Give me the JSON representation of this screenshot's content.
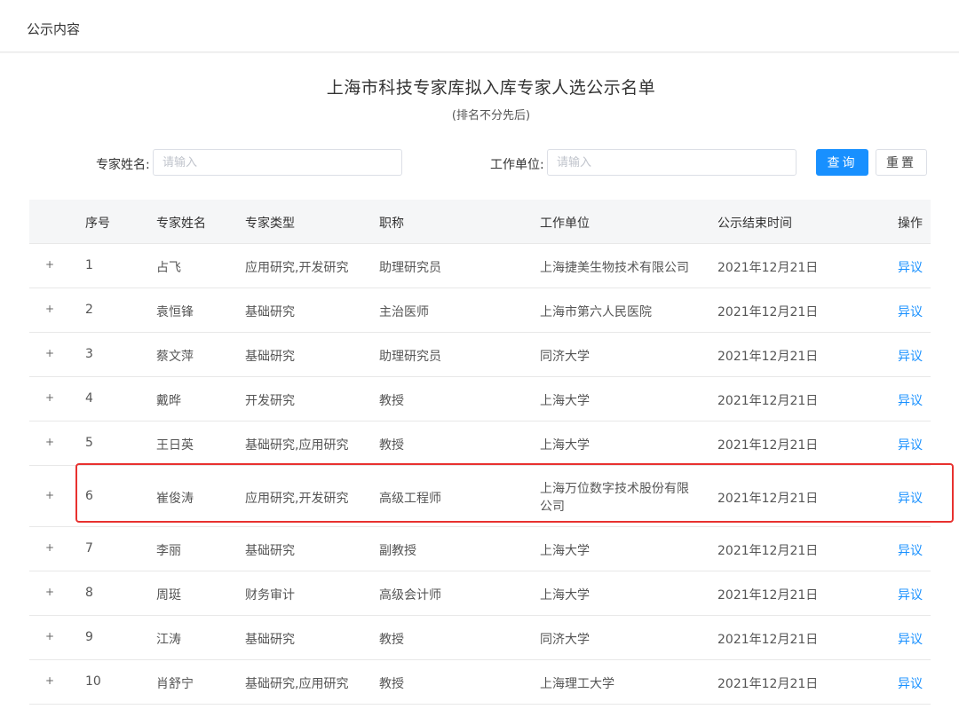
{
  "tab": {
    "title": "公示内容"
  },
  "page": {
    "title": "上海市科技专家库拟入库专家人选公示名单",
    "subtitle": "(排名不分先后)"
  },
  "filters": {
    "name_label": "专家姓名:",
    "name_placeholder": "请输入",
    "name_value": "",
    "unit_label": "工作单位:",
    "unit_placeholder": "请输入",
    "unit_value": "",
    "query_label": "查询",
    "reset_label": "重置"
  },
  "table": {
    "columns": [
      "序号",
      "专家姓名",
      "专家类型",
      "职称",
      "工作单位",
      "公示结束时间",
      "操作"
    ],
    "rows": [
      {
        "expand": "+",
        "no": "1",
        "name": "占飞",
        "type": "应用研究,开发研究",
        "title": "助理研究员",
        "unit": "上海捷美生物技术有限公司",
        "end": "2021年12月21日",
        "action": "异议"
      },
      {
        "expand": "+",
        "no": "2",
        "name": "袁恒锋",
        "type": "基础研究",
        "title": "主治医师",
        "unit": "上海市第六人民医院",
        "end": "2021年12月21日",
        "action": "异议"
      },
      {
        "expand": "+",
        "no": "3",
        "name": "蔡文萍",
        "type": "基础研究",
        "title": "助理研究员",
        "unit": "同济大学",
        "end": "2021年12月21日",
        "action": "异议"
      },
      {
        "expand": "+",
        "no": "4",
        "name": "戴晔",
        "type": "开发研究",
        "title": "教授",
        "unit": "上海大学",
        "end": "2021年12月21日",
        "action": "异议"
      },
      {
        "expand": "+",
        "no": "5",
        "name": "王日英",
        "type": "基础研究,应用研究",
        "title": "教授",
        "unit": "上海大学",
        "end": "2021年12月21日",
        "action": "异议"
      },
      {
        "expand": "+",
        "no": "6",
        "name": "崔俊涛",
        "type": "应用研究,开发研究",
        "title": "高级工程师",
        "unit": "上海万位数字技术股份有限公司",
        "end": "2021年12月21日",
        "action": "异议"
      },
      {
        "expand": "+",
        "no": "7",
        "name": "李丽",
        "type": "基础研究",
        "title": "副教授",
        "unit": "上海大学",
        "end": "2021年12月21日",
        "action": "异议"
      },
      {
        "expand": "+",
        "no": "8",
        "name": "周珽",
        "type": "财务审计",
        "title": "高级会计师",
        "unit": "上海大学",
        "end": "2021年12月21日",
        "action": "异议"
      },
      {
        "expand": "+",
        "no": "9",
        "name": "江涛",
        "type": "基础研究",
        "title": "教授",
        "unit": "同济大学",
        "end": "2021年12月21日",
        "action": "异议"
      },
      {
        "expand": "+",
        "no": "10",
        "name": "肖舒宁",
        "type": "基础研究,应用研究",
        "title": "教授",
        "unit": "上海理工大学",
        "end": "2021年12月21日",
        "action": "异议"
      }
    ]
  },
  "accent_color": "#1890ff",
  "highlight_color": "#e8312f"
}
